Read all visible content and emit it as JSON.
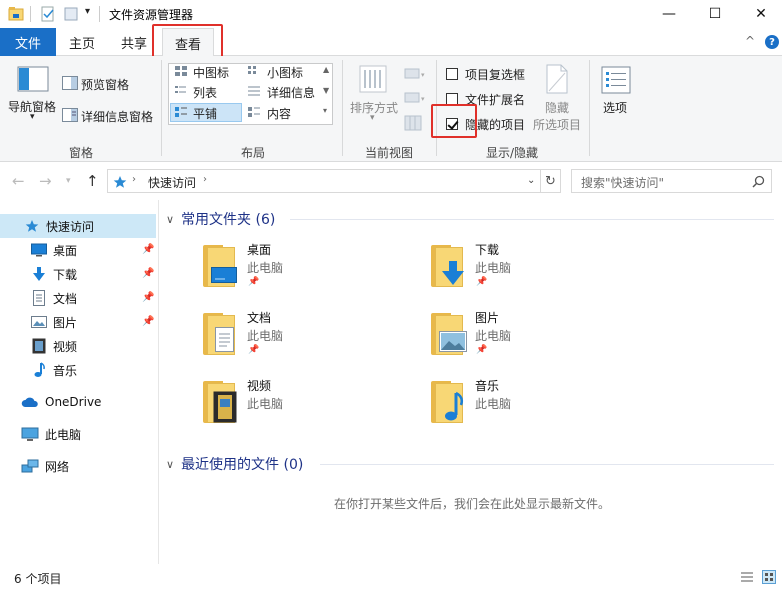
{
  "window": {
    "title": "文件资源管理器",
    "minimize": "—",
    "maximize": "☐",
    "close": "✕"
  },
  "ribbon_tabs": {
    "file": "文件",
    "home": "主页",
    "share": "共享",
    "view": "查看",
    "collapse": "^",
    "help": "?"
  },
  "ribbon": {
    "panes": {
      "nav_pane": "导航窗格",
      "preview_pane": "预览窗格",
      "details_pane": "详细信息窗格",
      "label": "窗格"
    },
    "layout": {
      "medium_icons": "中图标",
      "small_icons": "小图标",
      "list": "列表",
      "details": "详细信息",
      "tiles": "平铺",
      "content": "内容",
      "label": "布局"
    },
    "current_view": {
      "sort_by": "排序方式",
      "label": "当前视图"
    },
    "show_hide": {
      "item_checkboxes": "项目复选框",
      "file_extensions": "文件扩展名",
      "hidden_items": "隐藏的项目",
      "hide_selected_line1": "隐藏",
      "hide_selected_line2": "所选项目",
      "label": "显示/隐藏",
      "item_checkboxes_checked": false,
      "file_extensions_checked": false,
      "hidden_items_checked": true
    },
    "options": {
      "label": "选项"
    }
  },
  "address": {
    "path_root": "快速访问",
    "sep": "›",
    "search_placeholder": "搜索\"快速访问\""
  },
  "sidebar": {
    "quick_access": "快速访问",
    "items": [
      {
        "label": "桌面",
        "icon": "desktop-icon",
        "pinned": true
      },
      {
        "label": "下载",
        "icon": "download-icon",
        "pinned": true
      },
      {
        "label": "文档",
        "icon": "document-icon",
        "pinned": true
      },
      {
        "label": "图片",
        "icon": "picture-icon",
        "pinned": true
      },
      {
        "label": "视频",
        "icon": "video-icon",
        "pinned": false
      },
      {
        "label": "音乐",
        "icon": "music-icon",
        "pinned": false
      }
    ],
    "onedrive": "OneDrive",
    "this_pc": "此电脑",
    "network": "网络"
  },
  "content": {
    "frequent_title": "常用文件夹 (6)",
    "recent_title": "最近使用的文件 (0)",
    "empty_message": "在你打开某些文件后，我们会在此处显示最新文件。",
    "folders": [
      {
        "name": "桌面",
        "location": "此电脑",
        "pinned": true
      },
      {
        "name": "下载",
        "location": "此电脑",
        "pinned": true
      },
      {
        "name": "文档",
        "location": "此电脑",
        "pinned": true
      },
      {
        "name": "图片",
        "location": "此电脑",
        "pinned": true
      },
      {
        "name": "视频",
        "location": "此电脑",
        "pinned": false
      },
      {
        "name": "音乐",
        "location": "此电脑",
        "pinned": false
      }
    ]
  },
  "status": {
    "count": "6 个项目"
  },
  "colors": {
    "accent": "#1a6fc7",
    "highlight": "#e0302a",
    "folder": "#f8d775",
    "selection": "#cde8f7"
  }
}
